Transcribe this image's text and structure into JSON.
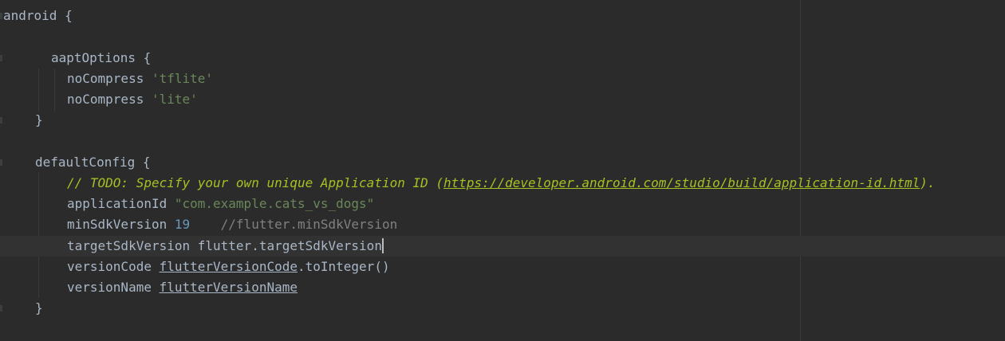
{
  "lines": {
    "android_open": "android {",
    "aapt_open": "aaptOptions {",
    "nocompress_kw": "noCompress ",
    "nocompress_1": "'tflite'",
    "nocompress_2": "'lite'",
    "close_brace": "}",
    "defaultconfig_open": "defaultConfig {",
    "todo_prefix": "// TODO: Specify your own unique Application ID (",
    "todo_url": "https://developer.android.com/studio/build/application-id.html",
    "todo_suffix": ").",
    "appid_kw": "applicationId ",
    "appid_val": "\"com.example.cats_vs_dogs\"",
    "minsdk_kw": "minSdkVersion ",
    "minsdk_val": "19",
    "minsdk_comment": "    //flutter.minSdkVersion",
    "targetsdk_text": "targetSdkVersion flutter.targetSdkVersion",
    "versioncode_kw": "versionCode ",
    "versioncode_ref": "flutterVersionCode",
    "versioncode_call": ".toInteger()",
    "versionname_kw": "versionName ",
    "versionname_ref": "flutterVersionName"
  },
  "theme": {
    "background": "#2b2b2b",
    "current_line": "#323232",
    "default_text": "#a9b7c6",
    "string": "#6a8759",
    "number": "#6897bb",
    "comment": "#808080",
    "todo": "#a8c023"
  }
}
